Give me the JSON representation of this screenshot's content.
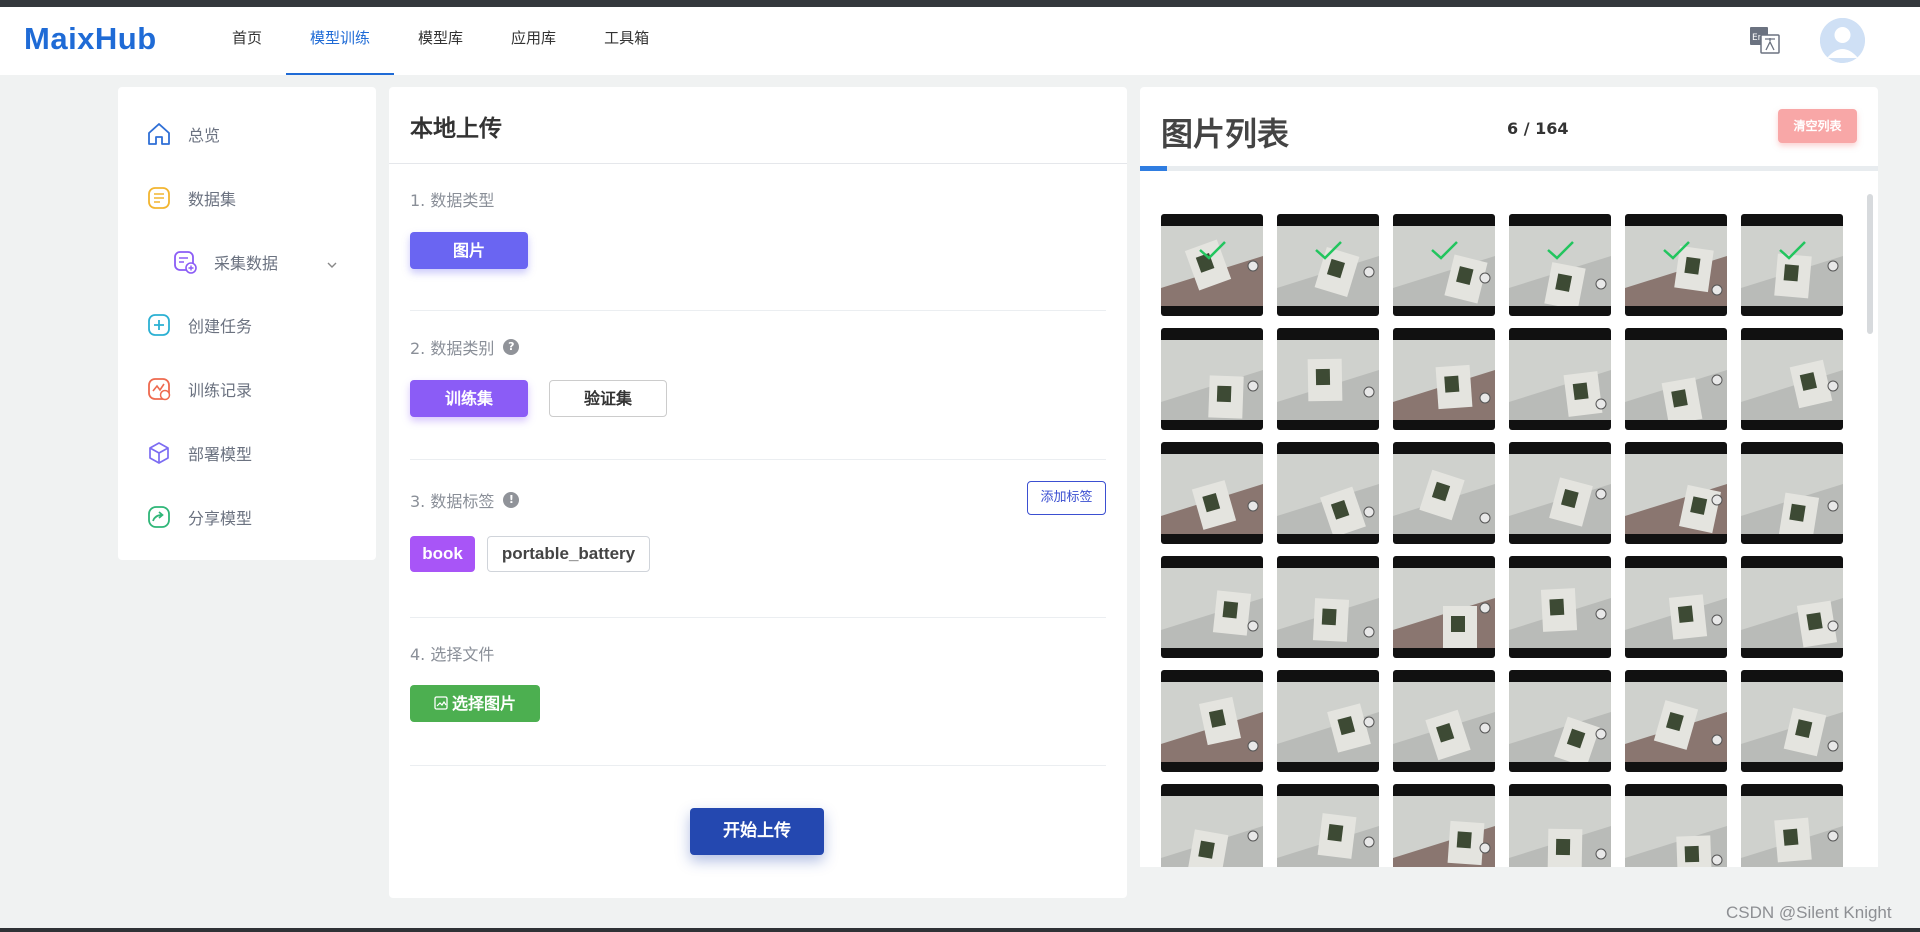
{
  "header": {
    "logo": "MaixHub",
    "nav": [
      "首页",
      "模型训练",
      "模型库",
      "应用库",
      "工具箱"
    ],
    "active_nav": 1,
    "lang_icon_text": "En"
  },
  "sidebar": {
    "items": [
      {
        "label": "总览",
        "icon": "home-icon",
        "color": "#2f6fd6"
      },
      {
        "label": "数据集",
        "icon": "dataset-icon",
        "color": "#f2b530"
      },
      {
        "label": "采集数据",
        "icon": "collect-data-icon",
        "color": "#8b5cf6"
      },
      {
        "label": "创建任务",
        "icon": "plus-square-icon",
        "color": "#2bb0d3"
      },
      {
        "label": "训练记录",
        "icon": "training-record-icon",
        "color": "#ee6a4f"
      },
      {
        "label": "部署模型",
        "icon": "cube-icon",
        "color": "#7c6cf2"
      },
      {
        "label": "分享模型",
        "icon": "share-icon",
        "color": "#2fb678"
      }
    ]
  },
  "upload": {
    "title": "本地上传",
    "section1": "1. 数据类型",
    "type_button": "图片",
    "section2": "2. 数据类别",
    "train_button": "训练集",
    "val_button": "验证集",
    "section3": "3. 数据标签",
    "add_tag_button": "添加标签",
    "tags": [
      "book",
      "portable_battery"
    ],
    "section4": "4. 选择文件",
    "select_button": "选择图片",
    "start_button": "开始上传"
  },
  "image_list": {
    "title": "图片列表",
    "count": "6 / 164",
    "clear_button": "清空列表",
    "progress_fraction": 0.0366,
    "uploaded_count": 6,
    "thumb_count": 36
  },
  "colors": {
    "accent": "#1f6bd6",
    "check": "#22c55e"
  },
  "watermark": "CSDN @Silent Knight"
}
